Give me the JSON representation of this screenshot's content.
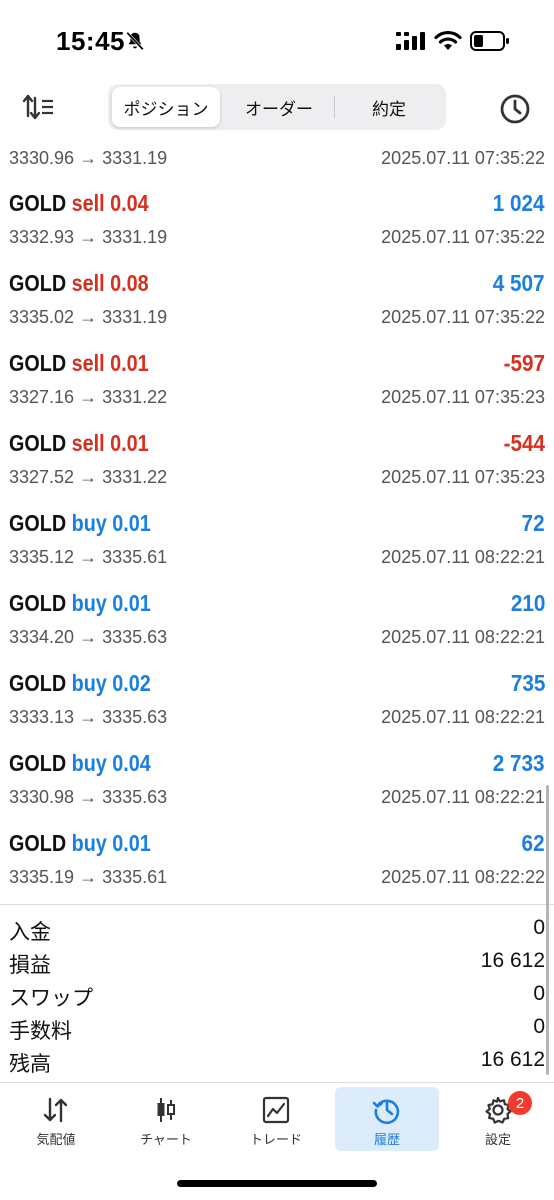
{
  "status": {
    "time": "15:45"
  },
  "toolbar": {
    "segments": [
      "ポジション",
      "オーダー",
      "約定"
    ],
    "active_segment": "ポジション"
  },
  "deals": [
    {
      "prices": "3330.96 → 3331.19",
      "time": "2025.07.11 07:35:22"
    },
    {
      "symbol": "GOLD",
      "type": "sell",
      "volume": "0.04",
      "profit": "1 024",
      "prices": "3332.93 → 3331.19",
      "time": "2025.07.11 07:35:22"
    },
    {
      "symbol": "GOLD",
      "type": "sell",
      "volume": "0.08",
      "profit": "4 507",
      "prices": "3335.02 → 3331.19",
      "time": "2025.07.11 07:35:22"
    },
    {
      "symbol": "GOLD",
      "type": "sell",
      "volume": "0.01",
      "profit": "-597",
      "prices": "3327.16 → 3331.22",
      "time": "2025.07.11 07:35:23"
    },
    {
      "symbol": "GOLD",
      "type": "sell",
      "volume": "0.01",
      "profit": "-544",
      "prices": "3327.52 → 3331.22",
      "time": "2025.07.11 07:35:23"
    },
    {
      "symbol": "GOLD",
      "type": "buy",
      "volume": "0.01",
      "profit": "72",
      "prices": "3335.12 → 3335.61",
      "time": "2025.07.11 08:22:21"
    },
    {
      "symbol": "GOLD",
      "type": "buy",
      "volume": "0.01",
      "profit": "210",
      "prices": "3334.20 → 3335.63",
      "time": "2025.07.11 08:22:21"
    },
    {
      "symbol": "GOLD",
      "type": "buy",
      "volume": "0.02",
      "profit": "735",
      "prices": "3333.13 → 3335.63",
      "time": "2025.07.11 08:22:21"
    },
    {
      "symbol": "GOLD",
      "type": "buy",
      "volume": "0.04",
      "profit": "2 733",
      "prices": "3330.98 → 3335.63",
      "time": "2025.07.11 08:22:21"
    },
    {
      "symbol": "GOLD",
      "type": "buy",
      "volume": "0.01",
      "profit": "62",
      "prices": "3335.19 → 3335.61",
      "time": "2025.07.11 08:22:22"
    }
  ],
  "summary": [
    {
      "label": "入金",
      "value": "0"
    },
    {
      "label": "損益",
      "value": "16 612"
    },
    {
      "label": "スワップ",
      "value": "0"
    },
    {
      "label": "手数料",
      "value": "0"
    },
    {
      "label": "残高",
      "value": "16 612"
    }
  ],
  "tabs": [
    {
      "label": "気配値",
      "icon": "quotes-arrows-icon"
    },
    {
      "label": "チャート",
      "icon": "candlestick-icon"
    },
    {
      "label": "トレード",
      "icon": "trade-chart-icon"
    },
    {
      "label": "履歴",
      "icon": "history-clock-icon",
      "active": true
    },
    {
      "label": "設定",
      "icon": "gear-icon",
      "badge": "2"
    }
  ],
  "colors": {
    "sell": "#d7301f",
    "buy": "#1a7ee3",
    "profit_positive": "#1a7ee3",
    "profit_negative": "#d7301f",
    "active_tab_bg": "#dcecfb",
    "badge": "#f23a2f"
  }
}
